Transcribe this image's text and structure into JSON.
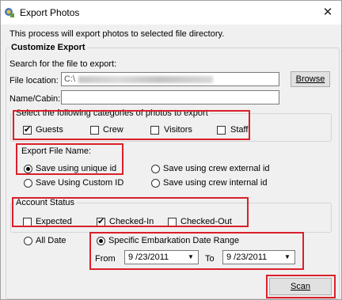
{
  "window": {
    "title": "Export Photos",
    "close_glyph": "✕"
  },
  "intro_text": "This process will export photos to selected file directory.",
  "customize": {
    "legend": "Customize Export",
    "search_label": "Search for the file to export:",
    "file_location_label": "File location:",
    "file_location_value": "C:\\",
    "browse_label": "Browse",
    "name_cabin_label": "Name/Cabin:",
    "name_cabin_value": ""
  },
  "categories": {
    "legend": "Select the following categories of photos to export",
    "items": [
      {
        "label": "Guests",
        "checked": true
      },
      {
        "label": "Crew",
        "checked": false
      },
      {
        "label": "Visitors",
        "checked": false
      },
      {
        "label": "Staff",
        "checked": false
      }
    ]
  },
  "export_file_name": {
    "label": "Export File Name:",
    "options": [
      {
        "label": "Save using unique id",
        "selected": true
      },
      {
        "label": "Save using crew external id",
        "selected": false
      },
      {
        "label": "Save Using Custom ID",
        "selected": false
      },
      {
        "label": "Save using crew internal id",
        "selected": false
      }
    ]
  },
  "account_status": {
    "legend": "Account Status",
    "items": [
      {
        "label": "Expected",
        "checked": false
      },
      {
        "label": "Checked-In",
        "checked": true
      },
      {
        "label": "Checked-Out",
        "checked": false
      }
    ]
  },
  "date_range": {
    "all_date_label": "All Date",
    "specific_label": "Specific Embarkation Date Range",
    "from_label": "From",
    "from_value": "9 /23/2011",
    "to_label": "To",
    "to_value": "9 /23/2011"
  },
  "scan_label": "Scan",
  "colors": {
    "highlight": "#d9202a",
    "window_bg": "#f0f0f0"
  }
}
